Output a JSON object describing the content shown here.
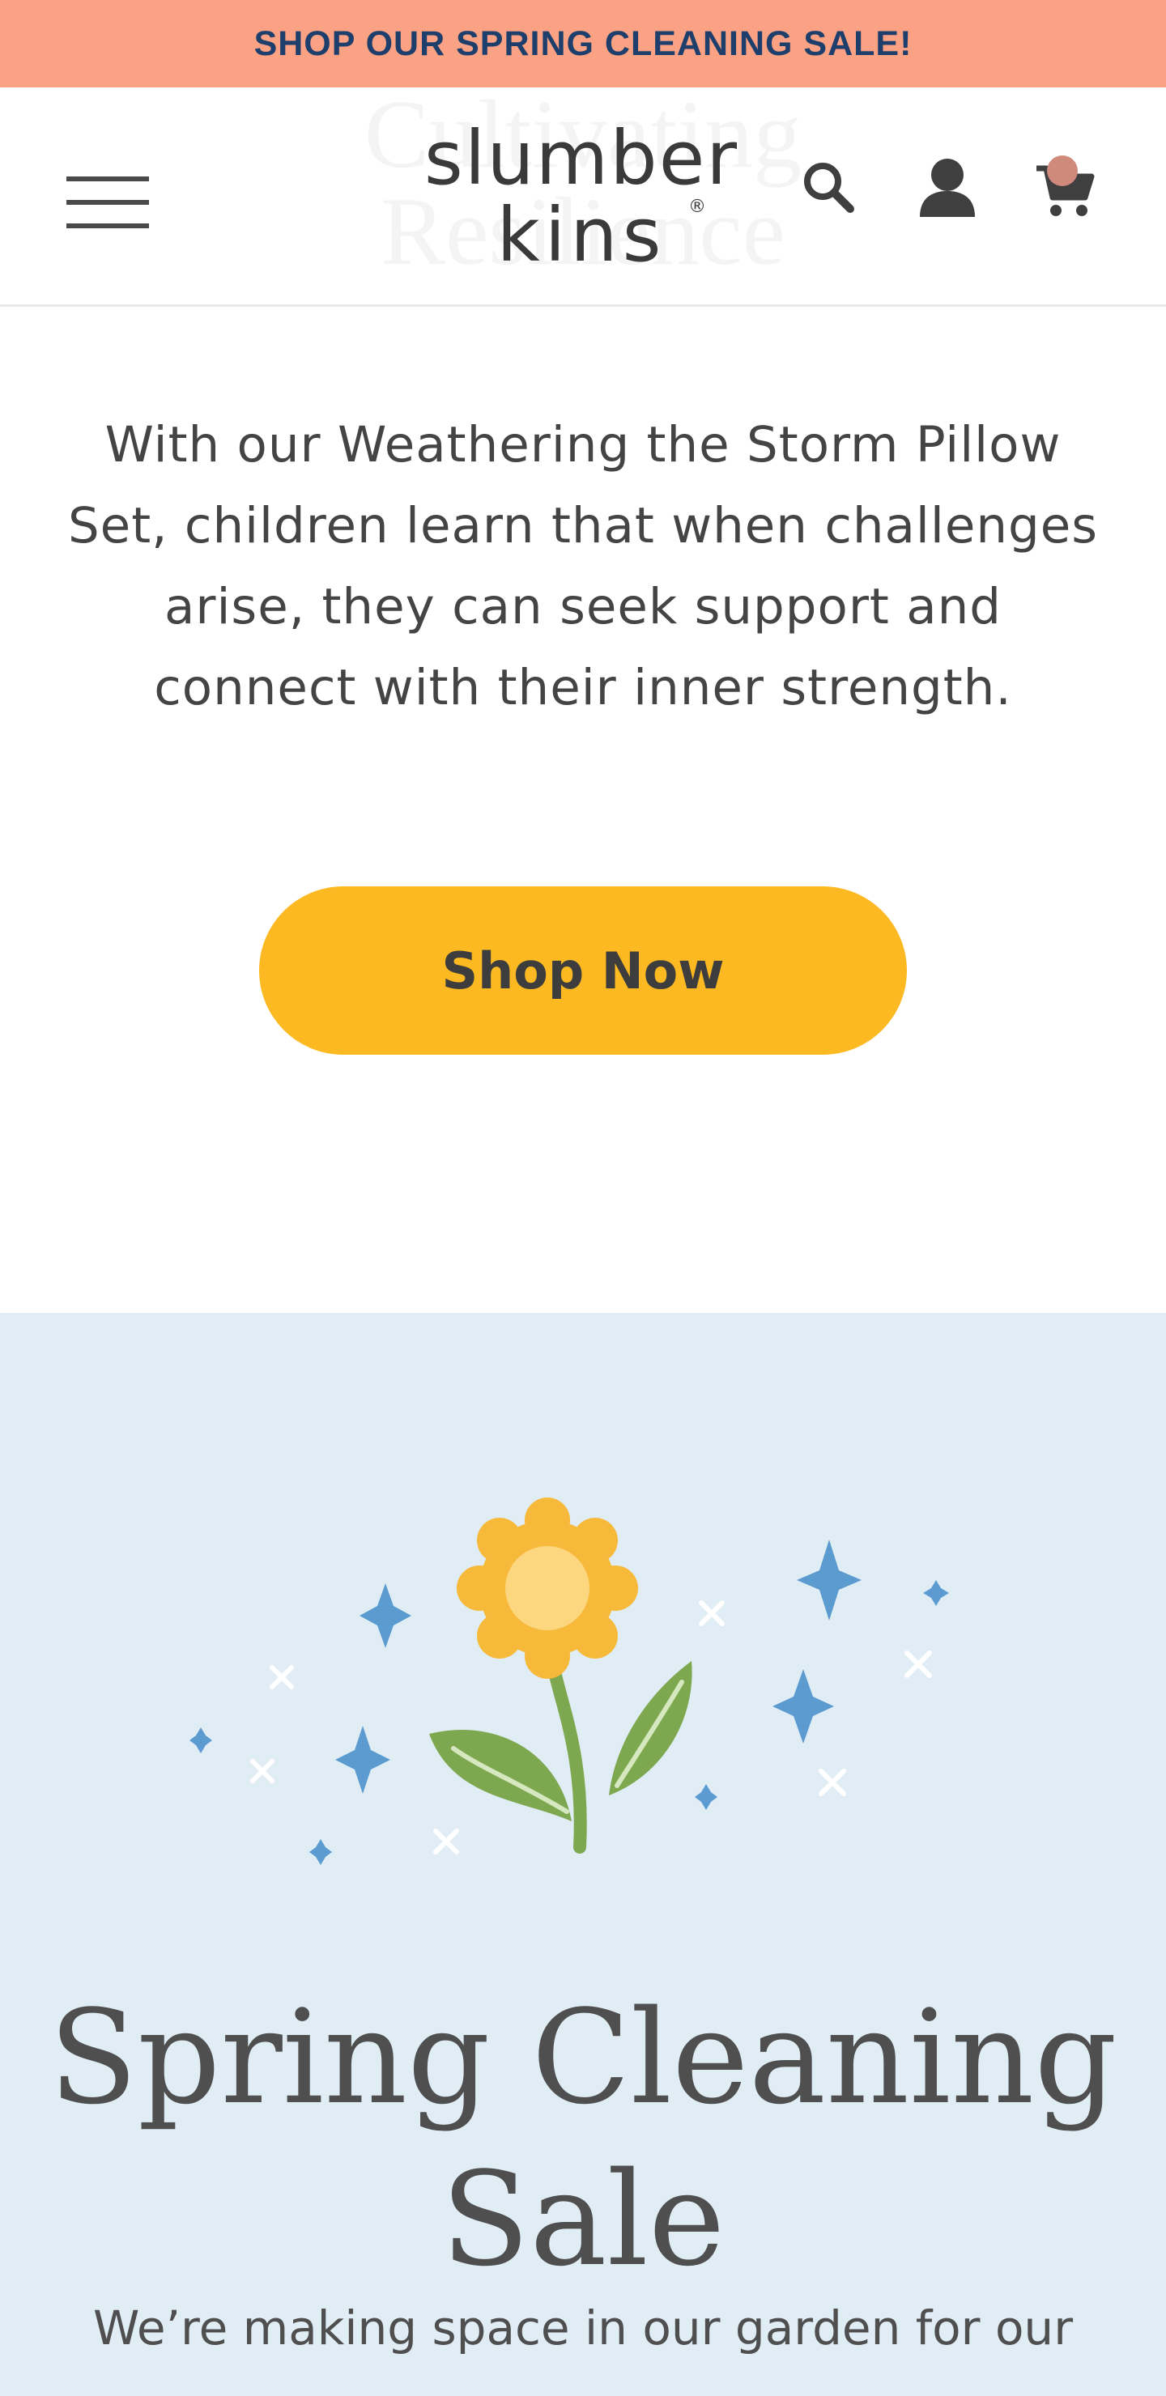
{
  "announcement": {
    "text": "SHOP OUR SPRING CLEANING SALE!"
  },
  "header": {
    "ghost_title_line1": "Cultivating",
    "ghost_title_line2": "Resilience",
    "logo_line1": "slumber",
    "logo_line2": "kins",
    "logo_mark": "®"
  },
  "hero": {
    "text_lines": [
      "With our Weathering the Storm Pillow",
      "Set, children learn that when challenges",
      "arise, they can seek support and",
      "connect with their inner strength."
    ],
    "button_label": "Shop Now"
  },
  "sale": {
    "title_line1": "Spring Cleaning",
    "title_line2": "Sale",
    "subtitle": "We’re making space in our garden for our"
  },
  "icons": {
    "menu": "hamburger-icon",
    "search": "search-icon",
    "account": "user-icon",
    "cart": "cart-icon"
  },
  "colors": {
    "announcement_bg": "#fba184",
    "announcement_text": "#1e3f6b",
    "button_bg": "#fcb921",
    "sale_bg": "#e0edf5",
    "sparkle_blue": "#5b9bd0",
    "flower_yellow": "#f7b93a",
    "leaf_green": "#7ea84f"
  }
}
